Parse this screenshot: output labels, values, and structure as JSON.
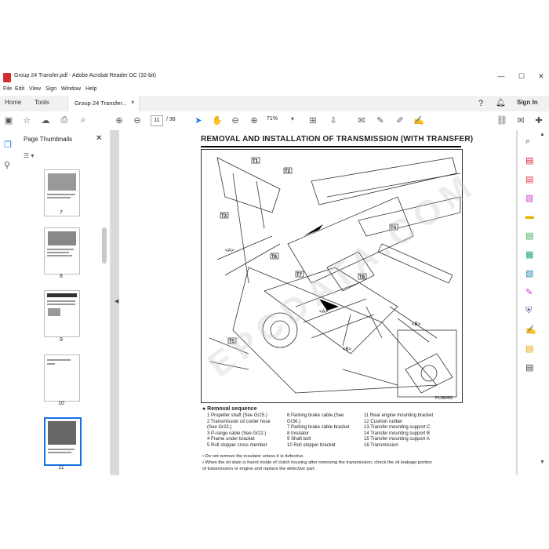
{
  "window": {
    "title": "Group 24 Transfer.pdf - Adobe Acrobat Reader DC (32-bit)",
    "controls": [
      "—",
      "☐",
      "✕"
    ]
  },
  "menu": [
    "File",
    "Edit",
    "View",
    "Sign",
    "Window",
    "Help"
  ],
  "tabs": {
    "home": "Home",
    "tools": "Tools",
    "doc": "Group 24 Transfer...",
    "doc_close": "×",
    "sign_in": "Sign In"
  },
  "toolbar": {
    "page_current": "11",
    "page_total": "/ 36",
    "zoom": "71%"
  },
  "thumbnails": {
    "header": "Page Thumbnails",
    "close": "✕",
    "options": "☰ ▾",
    "pages": [
      "7",
      "8",
      "9",
      "10",
      "11"
    ]
  },
  "document": {
    "heading": "REMOVAL AND INSTALLATION OF TRANSMISSION (WITH TRANSFER)",
    "figure_id": "P1158452",
    "callouts": [
      "<A>",
      "<B>",
      "T1",
      "T2",
      "T3",
      "T4",
      "T5",
      "T6",
      "T7",
      "T8"
    ],
    "removal_title": "● Removal sequence",
    "sequence_col1": [
      "1  Propeller shaft (See Gr25.)",
      "2  Transmission oil cooler hose",
      "    (See Gr22.)",
      "3  P-range cable (See Gr22.)",
      "4  Frame under bracket",
      "5  Roll stopper cross member"
    ],
    "sequence_col2": [
      "6  Parking brake cable (See",
      "    Gr36.)",
      "7  Parking brake cable bracket",
      "8  Insulator",
      "9  Shaft bolt",
      "10  Roll stopper bracket"
    ],
    "sequence_col3": [
      "11  Rear engine mounting bracket",
      "12  Cushion rubber",
      "13  Transfer mounting support C",
      "14  Transfer mounting support B",
      "15  Transfer mounting support A",
      "16  Transmission"
    ],
    "notes": [
      "• Do not remove the insulator unless it is defective.",
      "• When the oil stain is found inside of clutch housing after removing the transmission, check the oil leakage portion",
      "  of transmission or engine and replace the defective part."
    ],
    "watermark": "EPCDATA.COM"
  }
}
